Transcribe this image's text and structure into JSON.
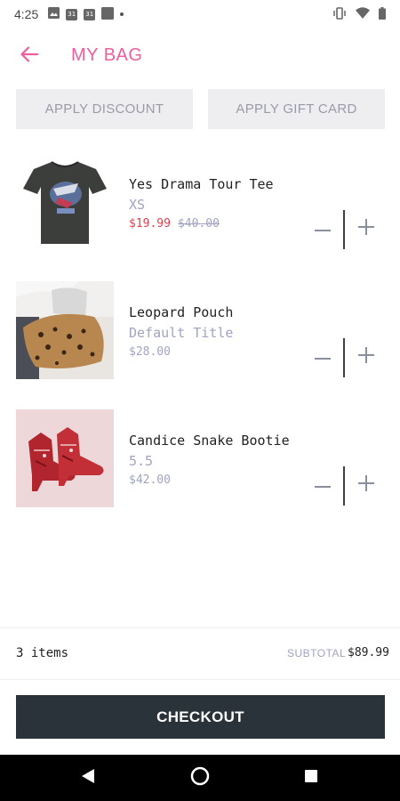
{
  "status_bar": {
    "time": "4:25",
    "calendar_day_1": "31",
    "calendar_day_2": "31"
  },
  "header": {
    "title": "MY BAG"
  },
  "actions": {
    "discount_label": "APPLY DISCOUNT",
    "gift_card_label": "APPLY GIFT CARD"
  },
  "items": [
    {
      "name": "Yes Drama Tour Tee",
      "variant": "XS",
      "sale_price": "$19.99",
      "original_price": "$40.00",
      "thumbnail": "black graphic t-shirt"
    },
    {
      "name": "Leopard Pouch",
      "variant": "Default Title",
      "price": "$28.00",
      "thumbnail": "leopard print pouch"
    },
    {
      "name": "Candice Snake Bootie",
      "variant": "5.5",
      "price": "$42.00",
      "thumbnail": "red snakeskin booties"
    }
  ],
  "summary": {
    "item_count": "3 items",
    "subtotal_label": "SUBTOTAL",
    "subtotal_value": "$89.99"
  },
  "checkout": {
    "label": "CHECKOUT"
  },
  "colors": {
    "accent_pink": "#ec5f9c",
    "sale_red": "#e0414e",
    "muted_lavender": "#a0a4c2",
    "checkout_dark": "#2a333a"
  }
}
